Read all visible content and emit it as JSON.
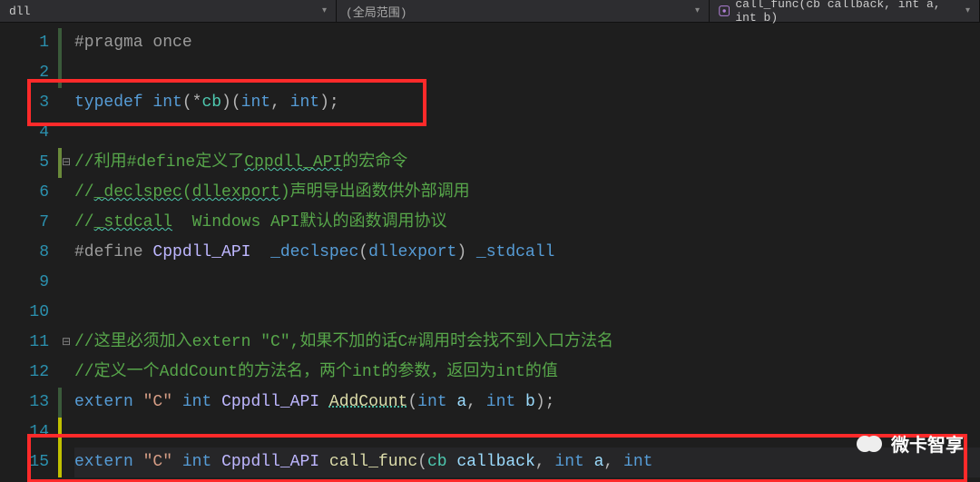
{
  "topbar": {
    "file": "dll",
    "scope": "(全局范围)",
    "func": "call_func(cb callback, int a, int b)"
  },
  "gutter": [
    "1",
    "2",
    "3",
    "4",
    "5",
    "6",
    "7",
    "8",
    "9",
    "10",
    "11",
    "12",
    "13",
    "14",
    "15"
  ],
  "fold": {
    "5": "⊟",
    "11": "⊟"
  },
  "code": {
    "l1": {
      "a": "#pragma",
      "b": " once"
    },
    "l3": {
      "a": "typedef ",
      "b": "int",
      "c": "(*",
      "d": "cb",
      "e": ")(",
      "f": "int",
      "g": ", ",
      "h": "int",
      "i": ");"
    },
    "l5": {
      "a": "//利用#define定义了",
      "b": "Cppdll_API",
      "c": "的宏命令"
    },
    "l6": {
      "a": "//",
      "b": "_declspec",
      "c": "(",
      "d": "dllexport",
      "e": ")声明导出函数供外部调用"
    },
    "l7": {
      "a": "//",
      "b": "_stdcall",
      "c": "  Windows API默认的函数调用协议"
    },
    "l8": {
      "a": "#define ",
      "b": "Cppdll_API",
      "c": "  ",
      "d": "_declspec",
      "e": "(",
      "f": "dllexport",
      "g": ") ",
      "h": "_stdcall"
    },
    "l11": {
      "a": "//这里必须加入extern \"C\",如果不加的话C#调用时会找不到入口方法名"
    },
    "l12": {
      "a": "//定义一个AddCount的方法名，两个int的参数，返回为int的值"
    },
    "l13": {
      "a": "extern ",
      "b": "\"C\"",
      "c": " ",
      "d": "int",
      "e": " ",
      "f": "Cppdll_API",
      "g": " ",
      "h": "AddCount",
      "i": "(",
      "j": "int",
      "k": " ",
      "l": "a",
      "m": ", ",
      "n": "int",
      "o": " ",
      "p": "b",
      "q": ");"
    },
    "l15": {
      "a": "extern ",
      "b": "\"C\"",
      "c": " ",
      "d": "int",
      "e": " ",
      "f": "Cppdll_API",
      "g": " ",
      "h": "call_func",
      "i": "(",
      "j": "cb",
      "k": " ",
      "l": "callback",
      "m": ", ",
      "n": "int",
      "o": " ",
      "p": "a",
      "q": ", ",
      "r": "int"
    }
  },
  "watermark": "微卡智享"
}
